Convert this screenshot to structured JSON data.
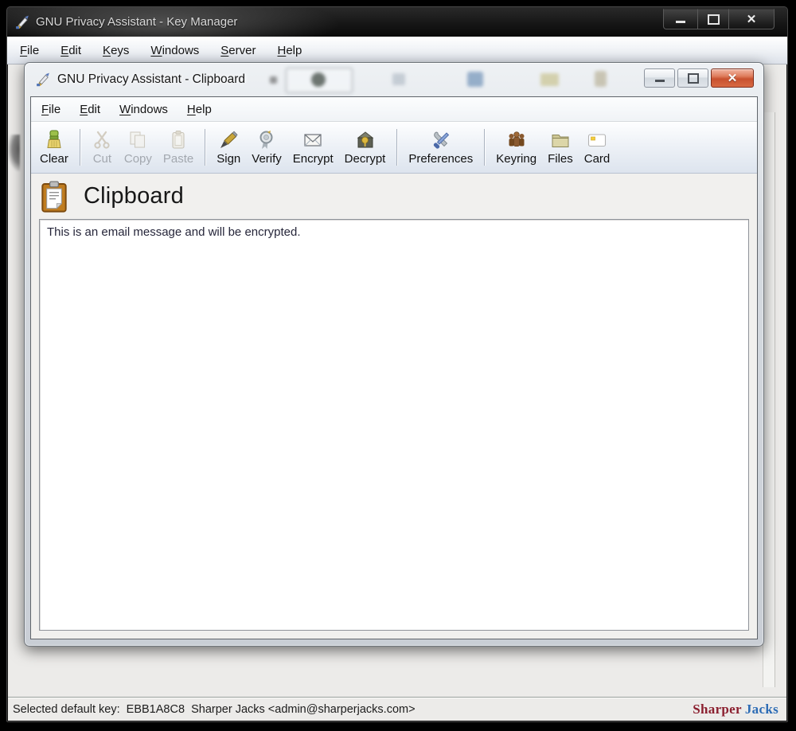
{
  "parent_window": {
    "title": "GNU Privacy Assistant - Key Manager",
    "menu": {
      "items": [
        {
          "label": "File"
        },
        {
          "label": "Edit"
        },
        {
          "label": "Keys"
        },
        {
          "label": "Windows"
        },
        {
          "label": "Server"
        },
        {
          "label": "Help"
        }
      ]
    },
    "window_controls": {
      "minimize": "minimize-icon",
      "maximize": "maximize-icon",
      "close": "close-icon"
    },
    "status_bar": {
      "text": "Selected default key:  EBB1A8C8  Sharper Jacks <admin@sharperjacks.com>"
    },
    "brand": {
      "word1": "Sharper",
      "word2": "Jacks",
      "word1_color": "#8b1f2f",
      "word2_color": "#2d6cb5"
    }
  },
  "clipboard_window": {
    "title": "GNU Privacy Assistant - Clipboard",
    "menu": {
      "items": [
        {
          "label": "File"
        },
        {
          "label": "Edit"
        },
        {
          "label": "Windows"
        },
        {
          "label": "Help"
        }
      ]
    },
    "window_controls": {
      "minimize": "minimize-icon",
      "maximize": "maximize-icon",
      "close": "close-icon"
    },
    "toolbar": {
      "buttons": [
        {
          "label": "Clear",
          "icon": "clear-brush-icon",
          "enabled": true
        },
        {
          "label": "Cut",
          "icon": "cut-scissors-icon",
          "enabled": false
        },
        {
          "label": "Copy",
          "icon": "copy-pages-icon",
          "enabled": false
        },
        {
          "label": "Paste",
          "icon": "paste-clipboard-icon",
          "enabled": false
        },
        {
          "label": "Sign",
          "icon": "sign-pen-icon",
          "enabled": true
        },
        {
          "label": "Verify",
          "icon": "verify-seal-icon",
          "enabled": true
        },
        {
          "label": "Encrypt",
          "icon": "encrypt-envelope-icon",
          "enabled": true
        },
        {
          "label": "Decrypt",
          "icon": "decrypt-envelope-icon",
          "enabled": true
        },
        {
          "label": "Preferences",
          "icon": "preferences-tools-icon",
          "enabled": true
        },
        {
          "label": "Keyring",
          "icon": "keyring-people-icon",
          "enabled": true
        },
        {
          "label": "Files",
          "icon": "files-folder-icon",
          "enabled": true
        },
        {
          "label": "Card",
          "icon": "smartcard-icon",
          "enabled": true
        }
      ]
    },
    "header": {
      "title": "Clipboard",
      "icon": "clipboard-icon"
    },
    "editor": {
      "text": "This is an email message and will be encrypted."
    }
  }
}
